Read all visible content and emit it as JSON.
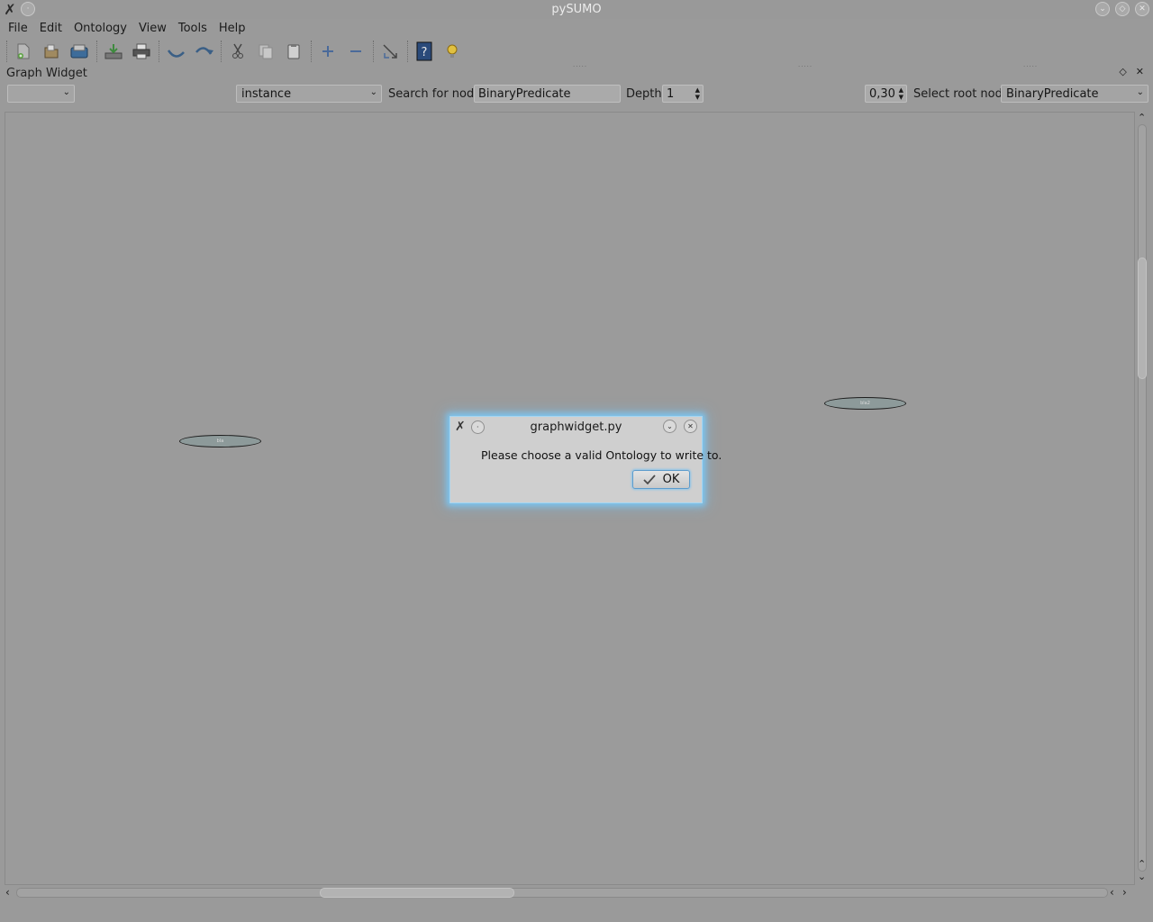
{
  "window": {
    "title": "pySUMO"
  },
  "menubar": {
    "items": [
      "File",
      "Edit",
      "Ontology",
      "View",
      "Tools",
      "Help"
    ]
  },
  "toolbar": {
    "icons": [
      "new-file-icon",
      "open-file-icon",
      "save-icon",
      "export-icon",
      "print-icon",
      "undo-icon",
      "redo-icon",
      "cut-icon",
      "copy-icon",
      "paste-icon",
      "zoom-in-icon",
      "zoom-out-icon",
      "expand-icon",
      "help-icon",
      "tip-icon"
    ]
  },
  "dock": {
    "title": "Graph Widget"
  },
  "controls": {
    "ontology_select": "",
    "relation_select": "instance",
    "search_label": "Search for node:",
    "search_value": "BinaryPredicate",
    "depth_label": "Depth",
    "depth_value": "1",
    "zoom_value": "0,30",
    "root_label": "Select root node",
    "root_value": "BinaryPredicate"
  },
  "graph": {
    "nodes": [
      {
        "label": "bla"
      },
      {
        "label": "bla2"
      }
    ]
  },
  "dialog": {
    "title": "graphwidget.py",
    "message": "Please choose a valid Ontology to write to.",
    "ok_label": "OK"
  }
}
